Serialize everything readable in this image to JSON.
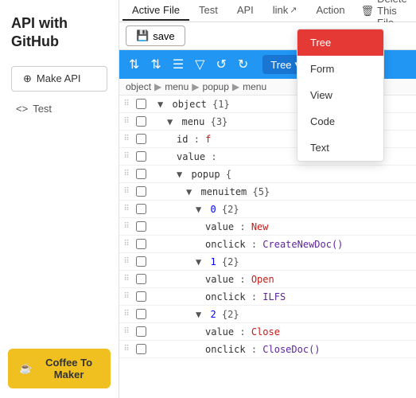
{
  "sidebar": {
    "title": "API with GitHub",
    "make_api_label": "Make API",
    "test_label": "Test",
    "coffee_label": "Coffee To Maker"
  },
  "tabs": [
    {
      "id": "active-file",
      "label": "Active File",
      "active": true
    },
    {
      "id": "test",
      "label": "Test",
      "active": false
    },
    {
      "id": "api",
      "label": "API",
      "active": false
    },
    {
      "id": "link",
      "label": "link",
      "active": false,
      "external": true
    },
    {
      "id": "action",
      "label": "Action",
      "active": false
    },
    {
      "id": "delete",
      "label": "Delete This File",
      "active": false
    }
  ],
  "save_label": "save",
  "toolbar": {
    "tree_label": "Tree",
    "icons": [
      "⇅",
      "⇅",
      "≡",
      "▽",
      "↺",
      "↻"
    ]
  },
  "dropdown": {
    "items": [
      "Tree",
      "Form",
      "View",
      "Code",
      "Text"
    ],
    "selected": "Tree"
  },
  "breadcrumb": [
    "object",
    "menu",
    "popup",
    "menu"
  ],
  "tree": {
    "rows": [
      {
        "indent": 1,
        "collapse": "▼",
        "content": "object {1}"
      },
      {
        "indent": 2,
        "collapse": "▼",
        "content": "menu {3}"
      },
      {
        "indent": 3,
        "content": "id  :  f"
      },
      {
        "indent": 3,
        "content": "value :  "
      },
      {
        "indent": 3,
        "collapse": "▼",
        "content": "popup {"
      },
      {
        "indent": 4,
        "collapse": "▼",
        "content": "menuitem {5}"
      },
      {
        "indent": 5,
        "collapse": "▼",
        "content": "0 {2}"
      },
      {
        "indent": 5,
        "content": "value :  New"
      },
      {
        "indent": 5,
        "content": "onclick :  CreateNewDoc()"
      },
      {
        "indent": 5,
        "collapse": "▼",
        "content": "1 {2}"
      },
      {
        "indent": 5,
        "content": "value :  Open"
      },
      {
        "indent": 5,
        "content": "onclick :  ILFS"
      },
      {
        "indent": 5,
        "collapse": "▼",
        "content": "2 {2}"
      },
      {
        "indent": 5,
        "content": "value :  Close"
      },
      {
        "indent": 5,
        "content": "onclick :  CloseDoc()"
      }
    ]
  }
}
